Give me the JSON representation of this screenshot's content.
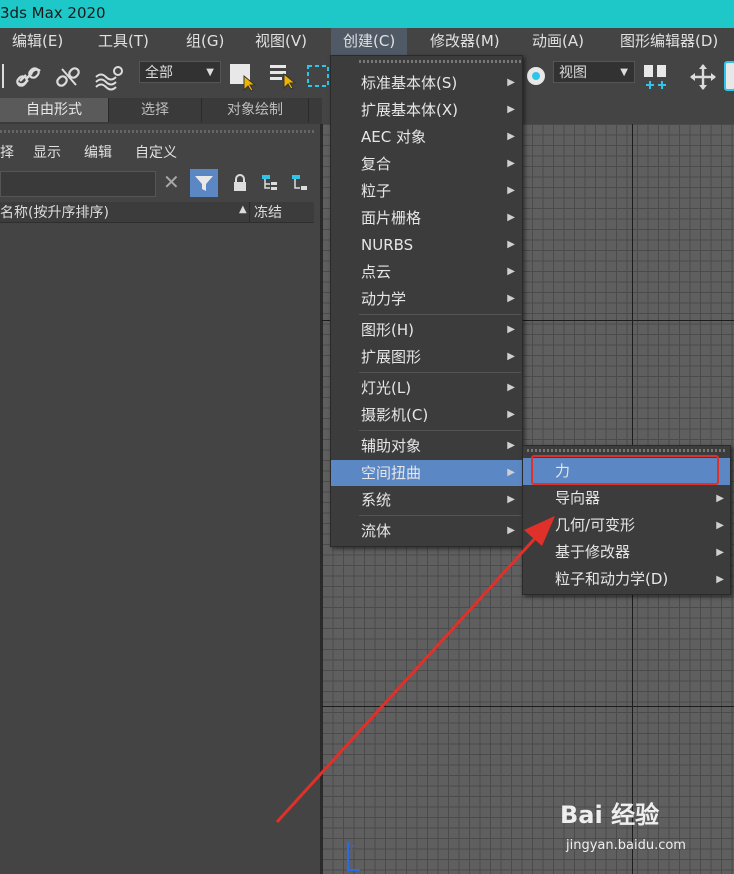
{
  "app": {
    "title": "3ds Max 2020"
  },
  "menubar": {
    "items": [
      {
        "label": "编辑(E)"
      },
      {
        "label": "工具(T)"
      },
      {
        "label": "组(G)"
      },
      {
        "label": "视图(V)"
      },
      {
        "label": "创建(C)"
      },
      {
        "label": "修改器(M)"
      },
      {
        "label": "动画(A)"
      },
      {
        "label": "图形编辑器(D)"
      }
    ]
  },
  "toolbar": {
    "selection_filter": "全部",
    "view_dropdown": "视图"
  },
  "ribbon_tabs": [
    {
      "label": "自由形式",
      "active": true
    },
    {
      "label": "选择",
      "active": false
    },
    {
      "label": "对象绘制",
      "active": false
    }
  ],
  "scene_explorer": {
    "menu": [
      "择",
      "显示",
      "编辑",
      "自定义"
    ],
    "columns": {
      "name": "名称(按升序排序)",
      "sort_indicator": "▲",
      "freeze": "冻结"
    }
  },
  "create_menu": {
    "items": [
      {
        "label": "标准基本体(S)",
        "submenu": true
      },
      {
        "label": "扩展基本体(X)",
        "submenu": true
      },
      {
        "label": "AEC 对象",
        "submenu": true
      },
      {
        "label": "复合",
        "submenu": true
      },
      {
        "label": "粒子",
        "submenu": true
      },
      {
        "label": "面片栅格",
        "submenu": true
      },
      {
        "label": "NURBS",
        "submenu": true
      },
      {
        "label": "点云",
        "submenu": true
      },
      {
        "label": "动力学",
        "submenu": true
      },
      {
        "label": "图形(H)",
        "submenu": true
      },
      {
        "label": "扩展图形",
        "submenu": true
      },
      {
        "label": "灯光(L)",
        "submenu": true
      },
      {
        "label": "摄影机(C)",
        "submenu": true
      },
      {
        "label": "辅助对象",
        "submenu": true
      },
      {
        "label": "空间扭曲",
        "submenu": true,
        "highlighted": true
      },
      {
        "label": "系统",
        "submenu": true
      },
      {
        "label": "流体",
        "submenu": true
      }
    ]
  },
  "spacewarp_submenu": {
    "items": [
      {
        "label": "力",
        "submenu": false,
        "highlighted": true
      },
      {
        "label": "导向器",
        "submenu": true
      },
      {
        "label": "几何/可变形",
        "submenu": true
      },
      {
        "label": "基于修改器",
        "submenu": true
      },
      {
        "label": "粒子和动力学(D)",
        "submenu": true
      }
    ]
  },
  "watermark": {
    "brand": "Bai 经验",
    "url": "jingyan.baidu.com"
  },
  "colors": {
    "titlebar": "#1ec8c8",
    "highlight": "#5b87c5",
    "annotation": "#e0302a"
  }
}
